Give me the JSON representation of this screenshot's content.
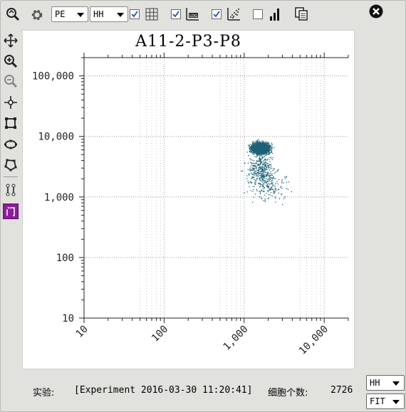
{
  "toolbar": {
    "x_param": "PE",
    "y_param": "HH",
    "grid_checked": true,
    "log_checked": true,
    "scatter_checked": true,
    "histogram_checked": false
  },
  "chart_data": {
    "type": "scatter",
    "title": "A11-2-P3-P8",
    "x_scale": "log",
    "y_scale": "log",
    "xlim": [
      10,
      20000
    ],
    "ylim": [
      10,
      200000
    ],
    "x_ticks": [
      "10",
      "100",
      "1,000",
      "10,000"
    ],
    "y_ticks": [
      "10",
      "100",
      "1,000",
      "10,000",
      "100,000"
    ],
    "grid": true,
    "point_color": "#1f6278",
    "cluster": {
      "center_x": 1600,
      "center_y": 6500,
      "count": 2726
    }
  },
  "status": {
    "experiment_label": "实验:",
    "experiment_value": "[Experiment 2016-03-30 11:20:41]",
    "cells_label": "细胞个数:",
    "cells_value": "2726"
  },
  "bottom": {
    "param_select": "HH",
    "fit_select": "FIT"
  }
}
